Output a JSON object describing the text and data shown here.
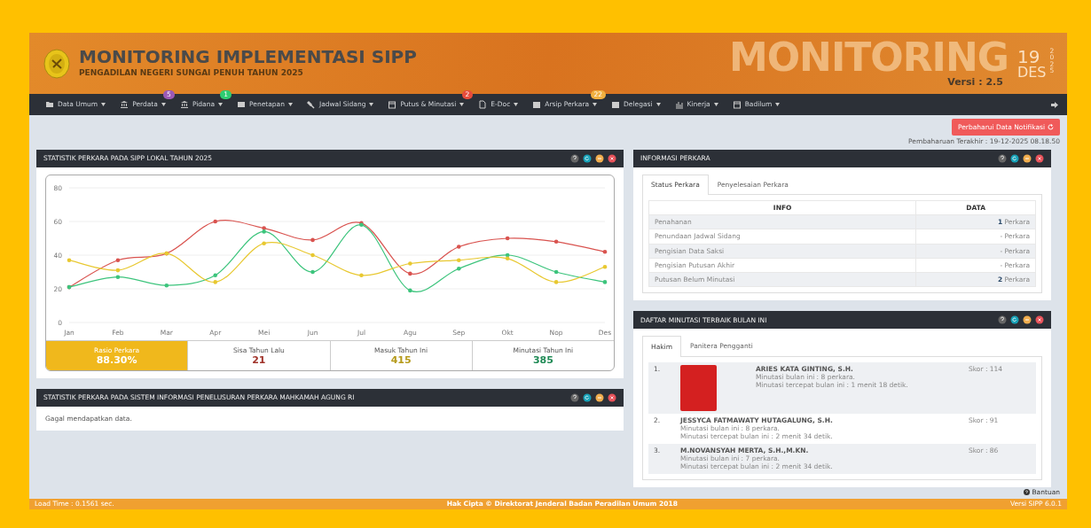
{
  "header": {
    "title": "MONITORING IMPLEMENTASI SIPP",
    "subtitle": "PENGADILAN NEGERI SUNGAI PENUH TAHUN 2025",
    "banner": "MONITORING",
    "version": "Versi : 2.5",
    "day": "19",
    "year": "2025",
    "month": "DES"
  },
  "nav": [
    {
      "label": "Data Umum"
    },
    {
      "label": "Perdata",
      "badge": "5",
      "color": "#9b59b6"
    },
    {
      "label": "Pidana",
      "badge": "1",
      "color": "#2ecc71"
    },
    {
      "label": "Penetapan"
    },
    {
      "label": "Jadwal Sidang"
    },
    {
      "label": "Putus & Minutasi",
      "badge": "2",
      "color": "#e74c3c"
    },
    {
      "label": "E-Doc"
    },
    {
      "label": "Arsip Perkara",
      "badge": "22",
      "color": "#f0b040"
    },
    {
      "label": "Delegasi"
    },
    {
      "label": "Kinerja"
    },
    {
      "label": "Badilum"
    }
  ],
  "notify_button": "Perbaharui Data Notifikasi",
  "last_update": "Pembaharuan Terakhir : 19-12-2025 08.18.50",
  "stat_panel": {
    "title": "STATISTIK PERKARA PADA SIPP LOKAL TAHUN 2025",
    "chart_data": {
      "type": "line",
      "categories": [
        "Jan",
        "Feb",
        "Mar",
        "Apr",
        "Mei",
        "Jun",
        "Jul",
        "Agu",
        "Sep",
        "Okt",
        "Nop",
        "Des"
      ],
      "yticks": [
        0,
        20,
        40,
        60,
        80
      ],
      "grid": true,
      "ylim": [
        0,
        80
      ],
      "series": [
        {
          "color": "#d9534f",
          "values": [
            21,
            37,
            41,
            60,
            56,
            49,
            59,
            29,
            45,
            50,
            48,
            42
          ]
        },
        {
          "color": "#3cc47c",
          "values": [
            21,
            27,
            22,
            28,
            54,
            30,
            58,
            19,
            32,
            40,
            30,
            24
          ]
        },
        {
          "color": "#e8c830",
          "values": [
            37,
            31,
            41,
            24,
            47,
            40,
            28,
            35,
            37,
            38,
            24,
            33
          ]
        }
      ]
    },
    "stats": [
      {
        "label": "Rasio Perkara",
        "value": "88.30%",
        "selected": true,
        "color": "#ffffff"
      },
      {
        "label": "Sisa Tahun Lalu",
        "value": "21",
        "selected": false,
        "color": "#a0332a"
      },
      {
        "label": "Masuk Tahun Ini",
        "value": "415",
        "selected": false,
        "color": "#b59a1a"
      },
      {
        "label": "Minutasi Tahun Ini",
        "value": "385",
        "selected": false,
        "color": "#1f8a55"
      }
    ]
  },
  "ma_panel": {
    "title": "STATISTIK PERKARA PADA SISTEM INFORMASI PENELUSURAN PERKARA MAHKAMAH AGUNG RI",
    "message": "Gagal mendapatkan data."
  },
  "info_panel": {
    "title": "INFORMASI PERKARA",
    "tabs": [
      {
        "label": "Status Perkara",
        "selected": true
      },
      {
        "label": "Penyelesaian Perkara",
        "selected": false
      }
    ],
    "columns": [
      "INFO",
      "DATA"
    ],
    "rows": [
      [
        "Penahanan",
        "**1** Perkara"
      ],
      [
        "Penundaan Jadwal Sidang",
        "- Perkara"
      ],
      [
        "Pengisian Data Saksi",
        "- Perkara"
      ],
      [
        "Pengisian Putusan Akhir",
        "- Perkara"
      ],
      [
        "Putusan Belum Minutasi",
        "**2** Perkara"
      ]
    ]
  },
  "best_panel": {
    "title": "DAFTAR MINUTASI TERBAIK BULAN INI",
    "tabs": [
      {
        "label": "Hakim",
        "selected": true
      },
      {
        "label": "Panitera Pengganti",
        "selected": false
      }
    ],
    "items": [
      {
        "rank": "1.",
        "photo": true,
        "name": "ARIES KATA GINTING, S.H.",
        "lines": [
          "Minutasi bulan ini : 8 perkara.",
          "Minutasi tercepat bulan ini : 1 menit 18 detik."
        ],
        "score": "Skor : 114"
      },
      {
        "rank": "2.",
        "photo": false,
        "name": "JESSYCA FATMAWATY HUTAGALUNG, S.H.",
        "lines": [
          "Minutasi bulan ini : 8 perkara.",
          "Minutasi tercepat bulan ini : 2 menit 34 detik."
        ],
        "score": "Skor : 91"
      },
      {
        "rank": "3.",
        "photo": false,
        "name": "M.NOVANSYAH MERTA, S.H.,M.KN.",
        "lines": [
          "Minutasi bulan ini : 7 perkara.",
          "Minutasi tercepat bulan ini : 2 menit 34 detik."
        ],
        "score": "Skor : 86"
      }
    ]
  },
  "help_link": "Bantuan",
  "footer": {
    "load_time": "Load Time : 0.1561 sec.",
    "copyright": "Hak Cipta © Direktorat Jenderal Badan Peradilan Umum 2018",
    "version": "Versi SIPP 6.0.1"
  }
}
